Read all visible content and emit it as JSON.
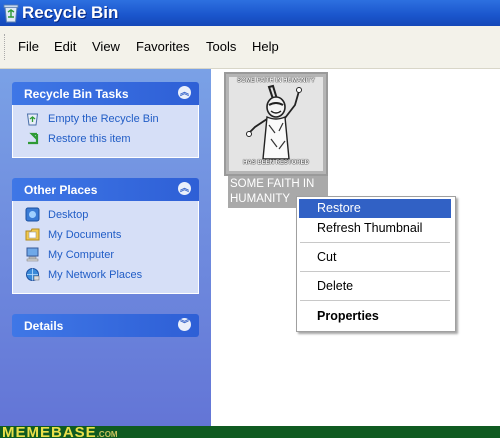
{
  "window": {
    "title": "Recycle Bin",
    "title_icon": "recycle-bin-icon"
  },
  "menubar": {
    "items": [
      "File",
      "Edit",
      "View",
      "Favorites",
      "Tools",
      "Help"
    ]
  },
  "sidebar": {
    "panels": [
      {
        "title": "Recycle Bin Tasks",
        "expanded": true,
        "tasks": [
          {
            "label": "Empty the Recycle Bin",
            "icon": "empty-recycle-bin-icon"
          },
          {
            "label": "Restore this item",
            "icon": "restore-item-icon"
          }
        ]
      },
      {
        "title": "Other Places",
        "expanded": true,
        "tasks": [
          {
            "label": "Desktop",
            "icon": "desktop-icon"
          },
          {
            "label": "My Documents",
            "icon": "my-documents-icon"
          },
          {
            "label": "My Computer",
            "icon": "my-computer-icon"
          },
          {
            "label": "My Network Places",
            "icon": "my-network-places-icon"
          }
        ]
      },
      {
        "title": "Details",
        "expanded": false,
        "tasks": []
      }
    ]
  },
  "file_item": {
    "thumbnail_top_text": "SOME FAITH IN HUMANITY",
    "thumbnail_bottom_text": "HAS BEEN RESTORED",
    "name": "SOME FAITH IN HUMANITY"
  },
  "context_menu": {
    "items": [
      {
        "label": "Restore",
        "selected": true,
        "bold": false
      },
      {
        "label": "Refresh Thumbnail",
        "selected": false,
        "bold": false
      },
      {
        "label": "Cut",
        "selected": false,
        "bold": false
      },
      {
        "label": "Delete",
        "selected": false,
        "bold": false
      },
      {
        "label": "Properties",
        "selected": false,
        "bold": true
      }
    ]
  },
  "footer": {
    "brand": "MEMEBASE",
    "suffix": ".COM"
  },
  "colors": {
    "title_bar": "#1a55cc",
    "sidebar": "#6d8ee0",
    "selection": "#3161c5",
    "footer": "#0f5b21",
    "footer_text": "#e9e04a"
  }
}
